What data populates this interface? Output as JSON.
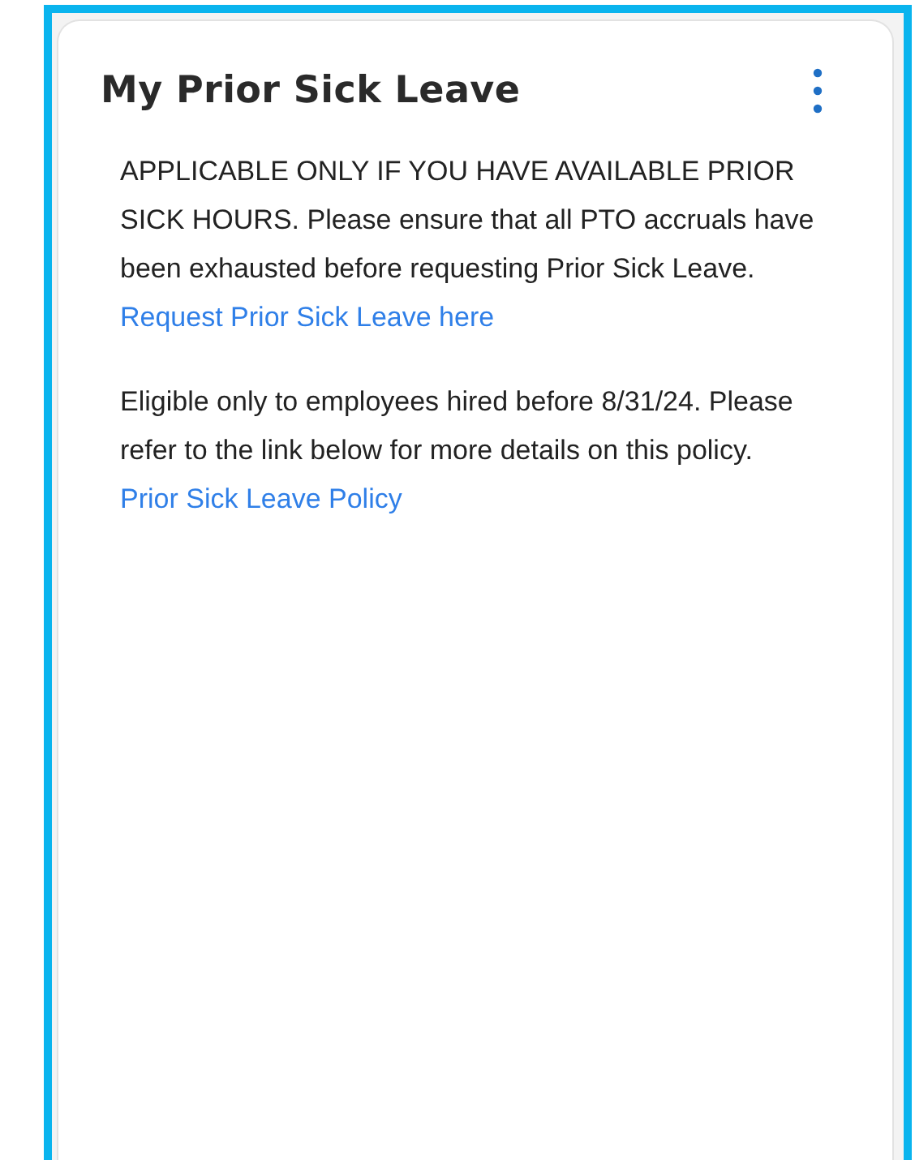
{
  "card": {
    "title": "My Prior Sick Leave",
    "sections": [
      {
        "text": "APPLICABLE ONLY IF YOU HAVE AVAILABLE PRIOR SICK HOURS. Please ensure that all PTO accruals have been exhausted before requesting Prior Sick Leave.",
        "link": "Request Prior Sick Leave here"
      },
      {
        "text": "Eligible only to employees hired before 8/31/24. Please refer to the link below for more details on this policy.",
        "link": "Prior Sick Leave Policy"
      }
    ]
  }
}
